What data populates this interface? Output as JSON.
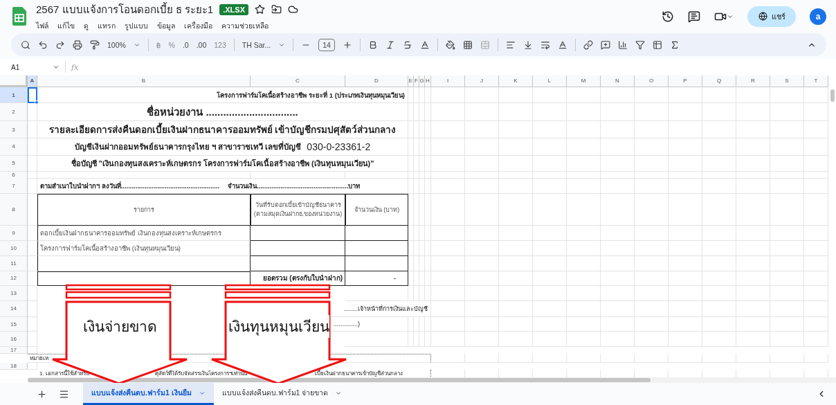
{
  "document": {
    "title": "2567 แบบแจ้งการโอนดอกเบี้ย ธ ระยะ1",
    "badge": ".XLSX"
  },
  "menu": [
    "ไฟล์",
    "แก้ไข",
    "ดู",
    "แทรก",
    "รูปแบบ",
    "ข้อมูล",
    "เครื่องมือ",
    "ความช่วยเหลือ"
  ],
  "share": {
    "label": "แชร์"
  },
  "avatar": {
    "initial": "a"
  },
  "toolbar": {
    "zoom": "100%",
    "currency": "฿",
    "percent": "%",
    "decimal_decrease": ".0",
    "decimal_increase": ".00",
    "number_format": "123",
    "font": "TH Sar...",
    "font_size": "14"
  },
  "formula_bar": {
    "name_box": "A1",
    "fx": "fx"
  },
  "columns": [
    {
      "label": "A",
      "selected": true
    },
    {
      "label": "B",
      "selected": false
    },
    {
      "label": "C",
      "selected": false
    },
    {
      "label": "D",
      "selected": false
    },
    {
      "label": "E",
      "selected": false
    },
    {
      "label": "F",
      "selected": false
    },
    {
      "label": "G",
      "selected": false
    },
    {
      "label": "H",
      "selected": false
    },
    {
      "label": "I",
      "selected": false
    },
    {
      "label": "J",
      "selected": false
    },
    {
      "label": "K",
      "selected": false
    },
    {
      "label": "L",
      "selected": false
    },
    {
      "label": "M",
      "selected": false
    },
    {
      "label": "N",
      "selected": false
    },
    {
      "label": "O",
      "selected": false
    },
    {
      "label": "P",
      "selected": false
    },
    {
      "label": "Q",
      "selected": false
    },
    {
      "label": "R",
      "selected": false
    },
    {
      "label": "S",
      "selected": false
    },
    {
      "label": "T",
      "selected": false
    }
  ],
  "rows": [
    {
      "number": "1",
      "selected": true,
      "kind": "title",
      "text": "โครงการฟาร์มโคเนื้อสร้างอาชีพ ระยะที่ 1 (ประเภทเงินทุนหมุนเวียน)"
    },
    {
      "number": "2",
      "selected": false,
      "kind": "heading_large",
      "text": "ชื่อหน่วยงาน ................................"
    },
    {
      "number": "3",
      "selected": false,
      "kind": "heading_medium",
      "text": "รายละเอียดการส่งคืนดอกเบี้ยเงินฝากธนาคารออมทรัพย์ เข้าบัญชีกรมปศุสัตว์ส่วนกลาง"
    },
    {
      "number": "4",
      "selected": false,
      "kind": "heading_account",
      "text": "บัญชีเงินฝากออมทรัพย์ธนาคารกรุงไทย ฯ สาขาราชเทวี เลขที่บัญชี",
      "account": "030-0-23361-2"
    },
    {
      "number": "5",
      "selected": false,
      "kind": "heading",
      "text": "ชื่อบัญชี  \"เงินกองทุนสงเคราะห์เกษตรกร โครงการฟาร์มโคเนื้อสร้างอาชีพ (เงินทุนหมุนเวียน)\""
    },
    {
      "number": "6",
      "selected": false,
      "kind": "spacer"
    },
    {
      "number": "7",
      "selected": false,
      "kind": "amount_line",
      "texts": [
        "ตามสำเนาใบนำฝากฯ ลงวันที่......................................................",
        "จำนวนเงิน..................................................บาท"
      ]
    },
    {
      "number": "8",
      "selected": false,
      "kind": "table_header",
      "cells": [
        "รายการ",
        "วันที่รับดอกเบี้ยเข้าบัญชีธนาคาร\n(ตามสมุดเงินฝากธ.ของหน่วยงาน)",
        "จำนวนเงิน (บาท)"
      ]
    },
    {
      "number": "9",
      "selected": false,
      "kind": "table_item",
      "cells": [
        "ดอกเบี้ยเงินฝากธนาคารออมทรัพย์ เงินกองทุนสงเคราะห์เกษตรกร"
      ]
    },
    {
      "number": "10",
      "selected": false,
      "kind": "table_item",
      "cells": [
        "โครงการฟาร์มโคเนื้อสร้างอาชีพ (เงินทุนหมุนเวียน)"
      ]
    },
    {
      "number": "11",
      "selected": false,
      "kind": "table_item",
      "cells": []
    },
    {
      "number": "12",
      "selected": false,
      "kind": "table_total",
      "label": "ยอดรวม (ตรงกับใบนำฝาก)",
      "value": "-"
    },
    {
      "number": "13",
      "selected": false,
      "kind": "blank"
    },
    {
      "number": "14",
      "selected": false,
      "kind": "signature",
      "text": "........เจ้าหน้าที่การเงินและบัญชี"
    },
    {
      "number": "15",
      "selected": false,
      "kind": "signature_close",
      "text": "..............)"
    },
    {
      "number": "16",
      "selected": false,
      "kind": "blank"
    },
    {
      "number": "17",
      "selected": false,
      "kind": "note",
      "texts": [
        "หมายเห"
      ]
    },
    {
      "number": "18",
      "selected": false,
      "kind": "note_item",
      "texts": [
        "1. เอกสารนี้ใช้สำหรับ",
        "ศุสัตว์ที่ได้รับจัดสรรเงินโครงการฯเท่านั้น",
        "เบี้ยเงินฝากธนาคารเข้าบัญชีส่วนกลาง"
      ]
    }
  ],
  "annotations": [
    {
      "label": "เงินจ่ายขาด"
    },
    {
      "label": "เงินทุนหมุนเวียน"
    }
  ],
  "sheet_tabs": [
    {
      "label": "แบบแจ้งส่งคืนดบ.ฟาร์ม1 เงินยืม",
      "selected": true
    },
    {
      "label": "แบบแจ้งส่งคืนดบ.ฟาร์ม1 จ่ายขาด",
      "selected": false
    }
  ]
}
